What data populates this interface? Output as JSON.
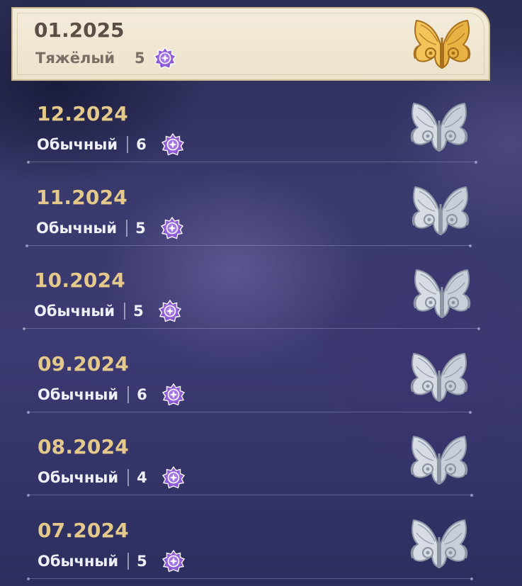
{
  "selected": {
    "date": "01.2025",
    "difficulty": "Тяжёлый",
    "stars": "5",
    "badge_icon": "gold-butterfly-emblem-icon",
    "star_icon": "purple-star-medal-icon"
  },
  "entries": [
    {
      "date": "12.2024",
      "difficulty": "Обычный",
      "stars": "6",
      "badge_icon": "silver-butterfly-emblem-icon"
    },
    {
      "date": "11.2024",
      "difficulty": "Обычный",
      "stars": "5",
      "badge_icon": "silver-butterfly-emblem-icon"
    },
    {
      "date": "10.2024",
      "difficulty": "Обычный",
      "stars": "5",
      "badge_icon": "silver-butterfly-emblem-icon"
    },
    {
      "date": "09.2024",
      "difficulty": "Обычный",
      "stars": "6",
      "badge_icon": "silver-butterfly-emblem-icon"
    },
    {
      "date": "08.2024",
      "difficulty": "Обычный",
      "stars": "4",
      "badge_icon": "silver-butterfly-emblem-icon"
    },
    {
      "date": "07.2024",
      "difficulty": "Обычный",
      "stars": "5",
      "badge_icon": "silver-butterfly-emblem-icon"
    }
  ],
  "colors": {
    "date_gold": "#e4c98a",
    "text_light": "#eef0f6",
    "card_bg": "#f4ecdb",
    "star_purple": "#8a55d6"
  }
}
